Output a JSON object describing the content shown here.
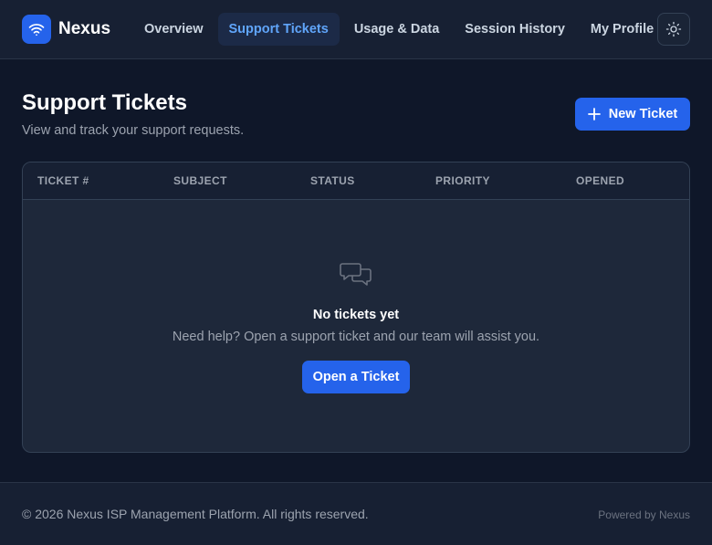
{
  "brand": {
    "name": "Nexus",
    "logo_icon": "wifi-icon"
  },
  "nav": {
    "items": [
      {
        "label": "Overview",
        "active": false
      },
      {
        "label": "Support Tickets",
        "active": true
      },
      {
        "label": "Usage & Data",
        "active": false
      },
      {
        "label": "Session History",
        "active": false
      },
      {
        "label": "My Profile",
        "active": false
      }
    ],
    "theme_toggle_icon": "sun-icon"
  },
  "page": {
    "title": "Support Tickets",
    "subtitle": "View and track your support requests.",
    "new_ticket_label": "New Ticket",
    "new_ticket_icon": "plus-icon"
  },
  "table": {
    "columns": [
      "TICKET #",
      "SUBJECT",
      "STATUS",
      "PRIORITY",
      "OPENED"
    ],
    "rows": []
  },
  "empty_state": {
    "icon": "chat-bubbles-icon",
    "title": "No tickets yet",
    "text": "Need help? Open a support ticket and our team will assist you.",
    "button_label": "Open a Ticket"
  },
  "footer": {
    "copyright": "© 2026 Nexus ISP Management Platform. All rights reserved.",
    "powered_by": "Powered by Nexus"
  },
  "colors": {
    "accent": "#2563eb",
    "active_nav_text": "#60a5fa",
    "background": "#0f1729",
    "surface": "#1e283a"
  }
}
